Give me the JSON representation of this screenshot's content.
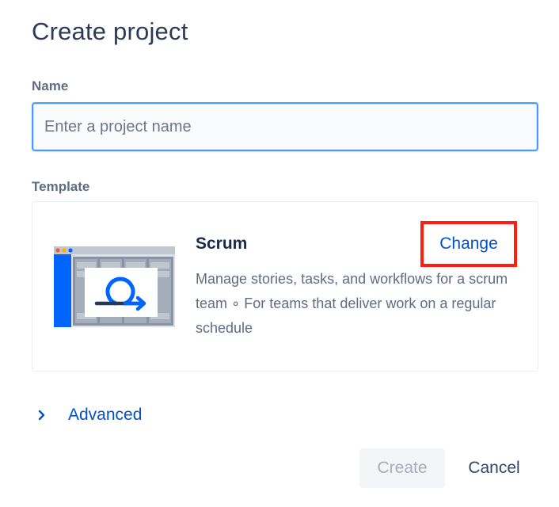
{
  "dialog": {
    "title": "Create project"
  },
  "name_field": {
    "label": "Name",
    "placeholder": "Enter a project name",
    "value": ""
  },
  "template": {
    "label": "Template",
    "name": "Scrum",
    "description": "Manage stories, tasks, and workflows for a scrum team ∘ For teams that deliver work on a regular schedule",
    "change_label": "Change",
    "illustration_icon": "scrum-board-illustration"
  },
  "advanced": {
    "label": "Advanced",
    "icon": "chevron-right-icon"
  },
  "footer": {
    "create_label": "Create",
    "cancel_label": "Cancel"
  },
  "colors": {
    "link": "#0052cc",
    "focus_border": "#4c9aff",
    "highlight_box": "#ff1e10",
    "illustration_blue": "#0065ff"
  }
}
